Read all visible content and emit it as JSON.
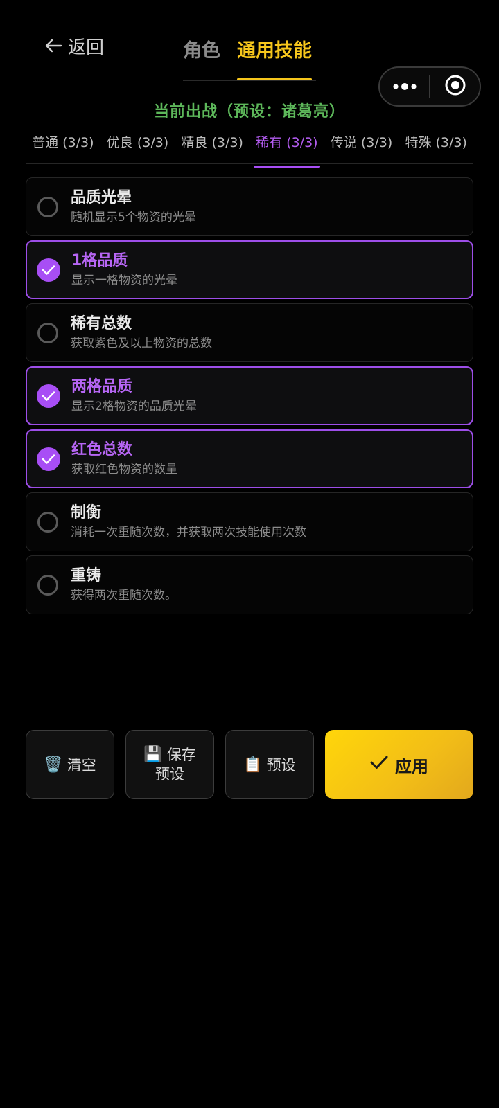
{
  "header": {
    "back_label": "返回",
    "tabs": [
      {
        "label": "角色",
        "active": false
      },
      {
        "label": "通用技能",
        "active": true
      }
    ],
    "capsule": {
      "more_icon": "more-dots-icon",
      "close_icon": "target-icon"
    }
  },
  "current_battle": "当前出战（预设：诸葛亮）",
  "rarity_tabs": [
    {
      "label": "普通 (3/3)",
      "active": false
    },
    {
      "label": "优良 (3/3)",
      "active": false
    },
    {
      "label": "精良 (3/3)",
      "active": false
    },
    {
      "label": "稀有 (3/3)",
      "active": true
    },
    {
      "label": "传说 (3/3)",
      "active": false
    },
    {
      "label": "特殊 (3/3)",
      "active": false
    }
  ],
  "skills": [
    {
      "name": "品质光晕",
      "desc": "随机显示5个物资的光晕",
      "selected": false
    },
    {
      "name": "1格品质",
      "desc": "显示一格物资的光晕",
      "selected": true
    },
    {
      "name": "稀有总数",
      "desc": "获取紫色及以上物资的总数",
      "selected": false
    },
    {
      "name": "两格品质",
      "desc": "显示2格物资的品质光晕",
      "selected": true
    },
    {
      "name": "红色总数",
      "desc": "获取红色物资的数量",
      "selected": true
    },
    {
      "name": "制衡",
      "desc": "消耗一次重随次数，并获取两次技能使用次数",
      "selected": false
    },
    {
      "name": "重铸",
      "desc": "获得两次重随次数。",
      "selected": false
    }
  ],
  "buttons": {
    "clear": {
      "icon": "🗑️",
      "label": "清空"
    },
    "save_preset": {
      "icon": "💾",
      "label_line1": "保存",
      "label_line2": "预设"
    },
    "preset": {
      "icon": "📋",
      "label": "预设"
    },
    "apply": {
      "label": "应用"
    }
  },
  "colors": {
    "accent_yellow": "#f6c61c",
    "accent_purple": "#a84ef5",
    "battle_green": "#5db75a"
  }
}
